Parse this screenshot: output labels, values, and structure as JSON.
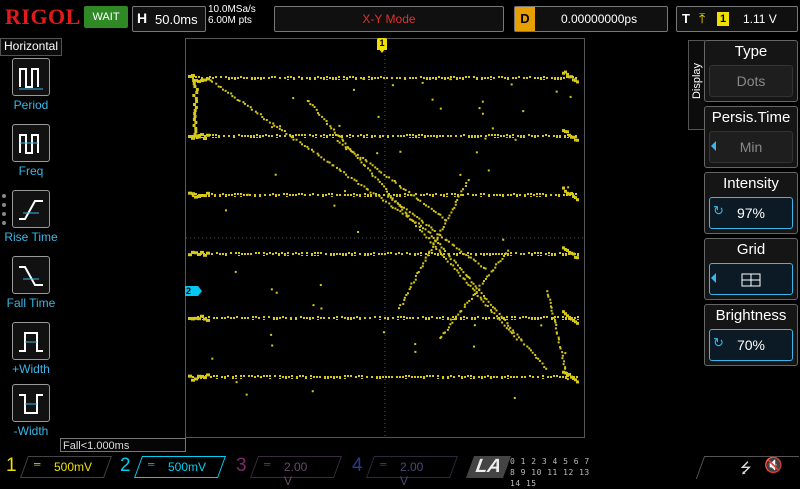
{
  "top_bar": {
    "brand": "RIGOL",
    "trigger_status": "WAIT",
    "horizontal": {
      "label": "H",
      "value": "50.0ms"
    },
    "sample_rate": "10.0MSa/s",
    "memory_depth": "6.00M pts",
    "mode": "X-Y Mode",
    "delay": {
      "label": "D",
      "value": "0.00000000ps"
    },
    "trigger": {
      "label": "T",
      "edge_glyph": "⤒",
      "source": "1",
      "level": "1.11 V"
    }
  },
  "left_panel": {
    "title": "Horizontal",
    "items": [
      {
        "label": "Period",
        "icon": "period-icon"
      },
      {
        "label": "Freq",
        "icon": "frequency-icon"
      },
      {
        "label": "Rise Time",
        "icon": "rise-time-icon"
      },
      {
        "label": "Fall Time",
        "icon": "fall-time-icon"
      },
      {
        "label": "+Width",
        "icon": "positive-width-icon"
      },
      {
        "label": "-Width",
        "icon": "negative-width-icon"
      }
    ]
  },
  "screen": {
    "marker_top": "1",
    "marker_left": "2",
    "trace_color": "#d6c91a"
  },
  "measurement": "Fall<1.000ms",
  "right_menu": {
    "tab": "Display",
    "items": [
      {
        "title": "Type",
        "value": "Dots"
      },
      {
        "title": "Persis.Time",
        "value": "Min"
      },
      {
        "title": "Intensity",
        "value": "97%"
      },
      {
        "title": "Grid",
        "value": "grid-icon"
      },
      {
        "title": "Brightness",
        "value": "70%"
      }
    ]
  },
  "channels": [
    {
      "num": "1",
      "coupling": "═",
      "scale": "500mV",
      "color": "#f0e000"
    },
    {
      "num": "2",
      "coupling": "═",
      "scale": "500mV",
      "color": "#00d0f0"
    },
    {
      "num": "3",
      "coupling": "═",
      "scale": "2.00 V",
      "color": "#7a2a6a"
    },
    {
      "num": "4",
      "coupling": "═",
      "scale": "2.00 V",
      "color": "#2a3a8a"
    }
  ],
  "la": {
    "label": "LA",
    "bits_row1": "0 1 2 3  4 5 6 7",
    "bits_row2": "8 9 10 11 12 13 14 15"
  },
  "status_icons": {
    "usb": "usb-icon",
    "speaker": "speaker-muted-icon"
  }
}
